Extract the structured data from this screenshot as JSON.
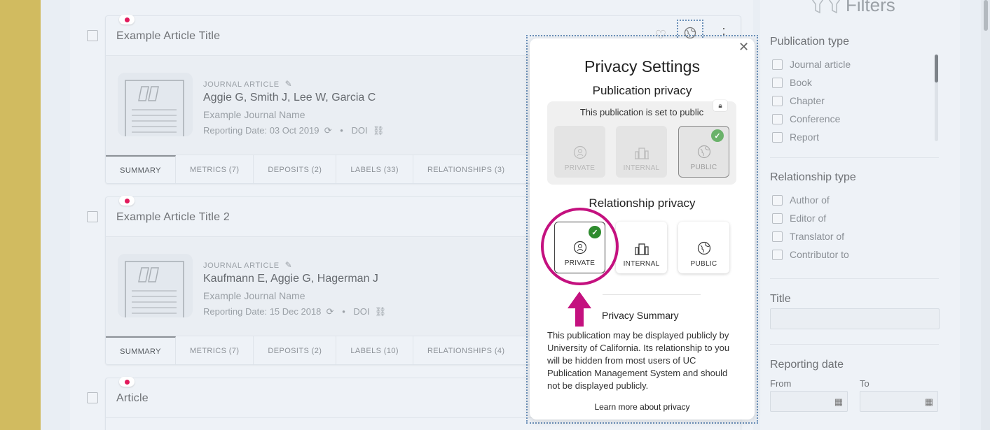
{
  "articles": [
    {
      "title": "Example Article Title",
      "pub_type": "JOURNAL ARTICLE",
      "authors": "Aggie G, Smith J, Lee W, Garcia C",
      "journal": "Example Journal Name",
      "reporting_date_label": "Reporting Date:",
      "reporting_date": "03 Oct 2019",
      "doi_label": "DOI",
      "tabs": [
        "SUMMARY",
        "METRICS (7)",
        "DEPOSITS (2)",
        "LABELS (33)",
        "RELATIONSHIPS (3)"
      ]
    },
    {
      "title": "Example Article Title 2",
      "pub_type": "JOURNAL ARTICLE",
      "authors": "Kaufmann E, Aggie G, Hagerman J",
      "journal": "Example Journal Name",
      "reporting_date_label": "Reporting Date:",
      "reporting_date": "15 Dec 2018",
      "doi_label": "DOI",
      "tabs": [
        "SUMMARY",
        "METRICS (7)",
        "DEPOSITS (2)",
        "LABELS (10)",
        "RELATIONSHIPS (4)"
      ]
    },
    {
      "title": "Article"
    }
  ],
  "filters": {
    "title": "Filters",
    "publication_type": {
      "heading": "Publication type",
      "items": [
        "Journal article",
        "Book",
        "Chapter",
        "Conference",
        "Report"
      ]
    },
    "relationship_type": {
      "heading": "Relationship type",
      "items": [
        "Author of",
        "Editor of",
        "Translator of",
        "Contributor to"
      ]
    },
    "title_field": {
      "heading": "Title",
      "value": ""
    },
    "reporting_date": {
      "heading": "Reporting date",
      "from_label": "From",
      "to_label": "To"
    }
  },
  "privacy": {
    "title": "Privacy Settings",
    "publication_privacy": {
      "heading": "Publication privacy",
      "status_text": "This publication is set to public",
      "options": [
        "PRIVATE",
        "INTERNAL",
        "PUBLIC"
      ],
      "selected": "PUBLIC"
    },
    "relationship_privacy": {
      "heading": "Relationship privacy",
      "options": [
        "PRIVATE",
        "INTERNAL",
        "PUBLIC"
      ],
      "selected": "PRIVATE"
    },
    "summary_title": "Privacy Summary",
    "summary_text": "This publication may be displayed publicly by University of California. Its relationship to you will be hidden from most users of UC Publication Management System and should not be displayed publicly.",
    "learn_more": "Learn more about privacy"
  },
  "colors": {
    "accent_highlight": "#c4117f",
    "check_green": "#2e8b2e",
    "left_strip": "#d1bb60"
  }
}
